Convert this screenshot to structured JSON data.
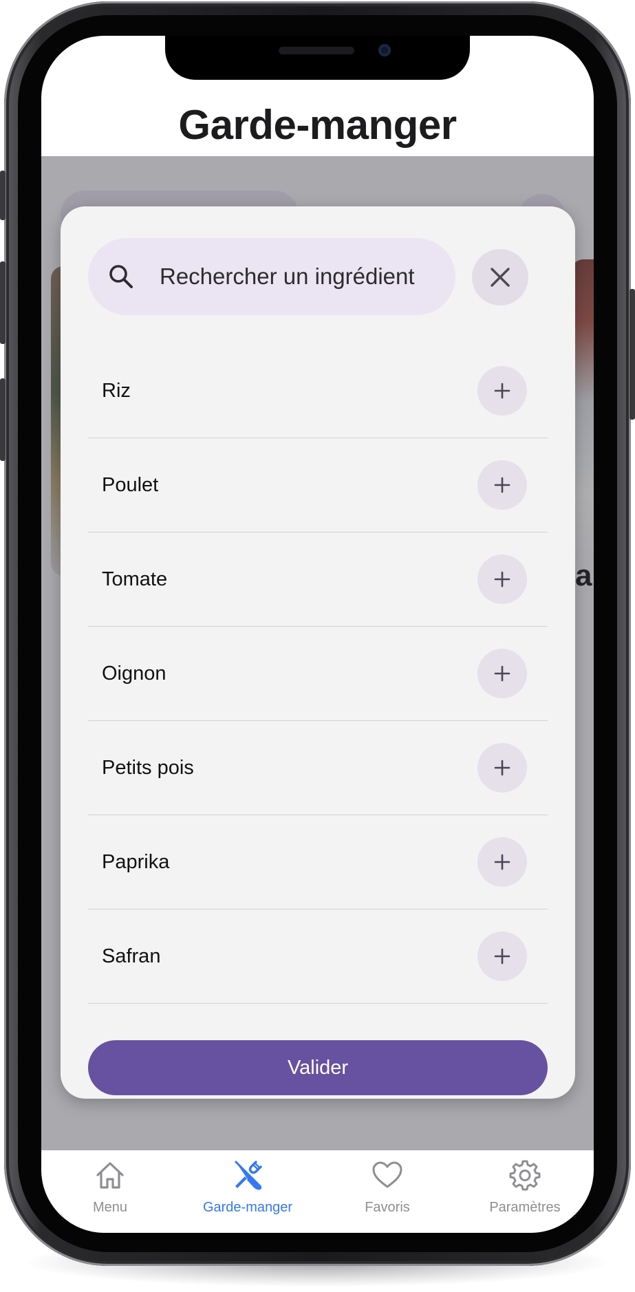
{
  "header": {
    "title": "Garde-manger"
  },
  "search": {
    "placeholder": "Rechercher un ingrédient"
  },
  "ingredients": [
    {
      "label": "Riz"
    },
    {
      "label": "Poulet"
    },
    {
      "label": "Tomate"
    },
    {
      "label": "Oignon"
    },
    {
      "label": "Petits pois"
    },
    {
      "label": "Paprika"
    },
    {
      "label": "Safran"
    }
  ],
  "modal": {
    "validate_label": "Valider"
  },
  "background": {
    "card_partial_text": "al"
  },
  "tabbar": {
    "tabs": [
      {
        "label": "Menu",
        "icon": "house-icon",
        "active": false
      },
      {
        "label": "Garde-manger",
        "icon": "utensils-crossed-icon",
        "active": true
      },
      {
        "label": "Favoris",
        "icon": "heart-icon",
        "active": false
      },
      {
        "label": "Paramètres",
        "icon": "gear-icon",
        "active": false
      }
    ]
  },
  "colors": {
    "accent": "#6652a0",
    "active_tab": "#3478f6",
    "inactive_tab": "#8e8e93",
    "search_bg": "#ebe5f3"
  }
}
